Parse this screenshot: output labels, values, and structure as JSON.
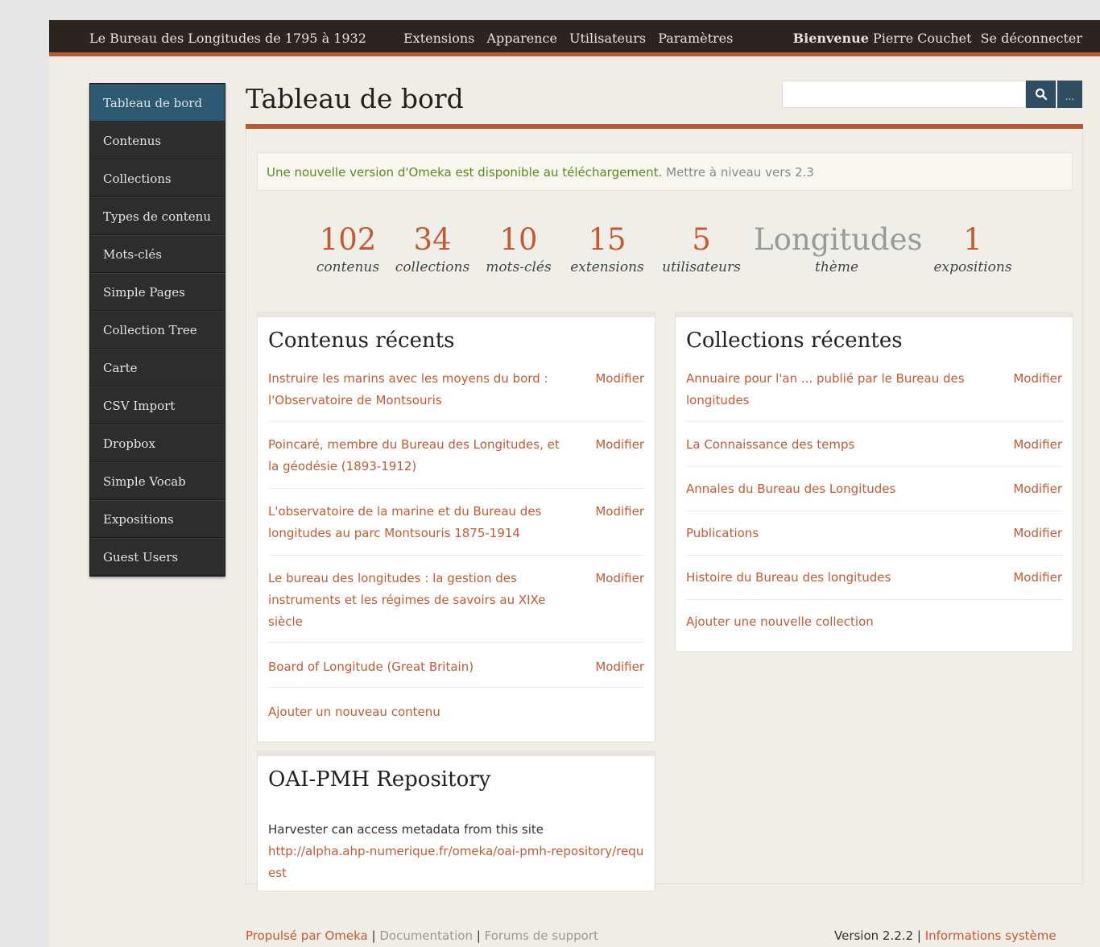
{
  "topbar": {
    "site_title": "Le Bureau des Longitudes de 1795 à 1932",
    "nav": [
      "Extensions",
      "Apparence",
      "Utilisateurs",
      "Paramètres"
    ],
    "welcome": "Bienvenue",
    "user_name": "Pierre Couchet",
    "logout": "Se déconnecter"
  },
  "sidebar": {
    "items": [
      "Tableau de bord",
      "Contenus",
      "Collections",
      "Types de contenu",
      "Mots-clés",
      "Simple Pages",
      "Collection Tree",
      "Carte",
      "CSV Import",
      "Dropbox",
      "Simple Vocab",
      "Expositions",
      "Guest Users"
    ],
    "active_index": 0
  },
  "header": {
    "title": "Tableau de bord",
    "search_value": "",
    "more_label": "..."
  },
  "notice": {
    "message": "Une nouvelle version d'Omeka est disponible au téléchargement.",
    "link": "Mettre à niveau vers 2.3"
  },
  "stats": [
    {
      "value": "102",
      "label": "contenus"
    },
    {
      "value": "34",
      "label": "collections"
    },
    {
      "value": "10",
      "label": "mots-clés"
    },
    {
      "value": "15",
      "label": "extensions"
    },
    {
      "value": "5",
      "label": "utilisateurs"
    },
    {
      "value": "Longitudes",
      "label": "thème"
    },
    {
      "value": "1",
      "label": "expositions"
    }
  ],
  "recent_items": {
    "title": "Contenus récents",
    "edit_label": "Modifier",
    "rows": [
      "Instruire les marins avec les moyens du bord : l'Observatoire de Montsouris",
      "Poincaré, membre du Bureau des Longitudes, et la géodésie (1893-1912)",
      "L'observatoire de la marine et du Bureau des longitudes au parc Montsouris 1875-1914",
      "Le bureau des longitudes : la gestion des instruments et les régimes de savoirs au XIXe siècle",
      "Board of Longitude (Great Britain)"
    ],
    "add_label": "Ajouter un nouveau contenu"
  },
  "recent_collections": {
    "title": "Collections récentes",
    "edit_label": "Modifier",
    "rows": [
      "Annuaire pour l'an ... publié par le Bureau des longitudes",
      "La Connaissance des temps",
      "Annales du Bureau des Longitudes",
      "Publications",
      "Histoire du Bureau des longitudes"
    ],
    "add_label": "Ajouter une nouvelle collection"
  },
  "oai": {
    "title": "OAI-PMH Repository",
    "text": "Harvester can access metadata from this site",
    "url": "http://alpha.ahp-numerique.fr/omeka/oai-pmh-repository/request"
  },
  "footer": {
    "powered": "Propulsé par Omeka",
    "documentation": "Documentation",
    "forums": "Forums de support",
    "version": "Version 2.2.2",
    "system_info": "Informations système",
    "separator": "|"
  },
  "colors": {
    "accent": "#b55a35",
    "link": "#c45a34",
    "topbar": "#2a2521",
    "sidebar_active": "#2d5a73",
    "notice_text": "#5a8a1a"
  }
}
